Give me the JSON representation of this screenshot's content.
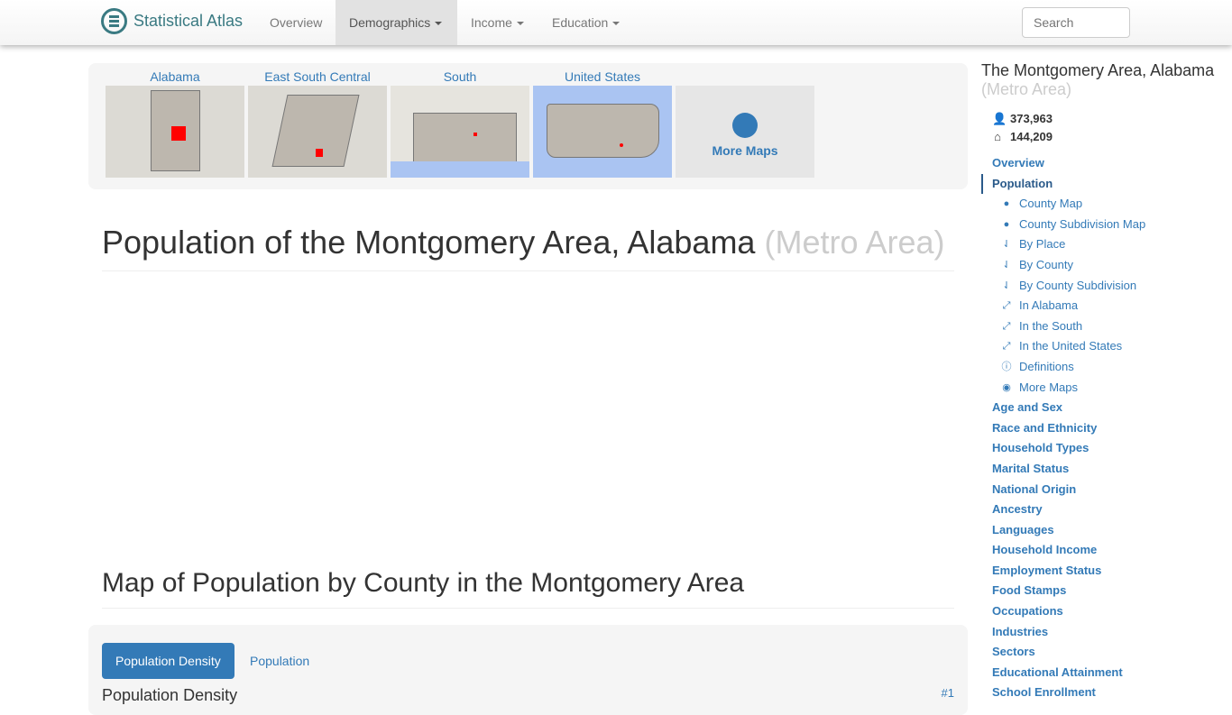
{
  "nav": {
    "brand": "Statistical Atlas",
    "items": [
      {
        "label": "Overview"
      },
      {
        "label": "Demographics",
        "dropdown": true,
        "active": true
      },
      {
        "label": "Income",
        "dropdown": true
      },
      {
        "label": "Education",
        "dropdown": true
      }
    ],
    "search_placeholder": "Search"
  },
  "maps": {
    "thumbs": [
      {
        "label": "Alabama"
      },
      {
        "label": "East South Central"
      },
      {
        "label": "South"
      },
      {
        "label": "United States"
      }
    ],
    "more_label": "More Maps"
  },
  "main": {
    "title": "Population of the Montgomery Area, Alabama",
    "title_muted": "(Metro Area)",
    "section_title": "Map of Population by County in the Montgomery Area",
    "tabs": [
      {
        "label": "Population Density",
        "active": true
      },
      {
        "label": "Population"
      }
    ],
    "subheading": "Population Density",
    "rank": "#1"
  },
  "sidebar": {
    "title": "The Montgomery Area, Alabama",
    "title_muted": "(Metro Area)",
    "population": "373,963",
    "households": "144,209",
    "items_top": [
      {
        "label": "Overview"
      },
      {
        "label": "Population",
        "current": true
      }
    ],
    "subitems": [
      {
        "label": "County Map",
        "icon": "map-marker-icon"
      },
      {
        "label": "County Subdivision Map",
        "icon": "map-marker-icon"
      },
      {
        "label": "By Place",
        "icon": "sort-icon"
      },
      {
        "label": "By County",
        "icon": "sort-icon"
      },
      {
        "label": "By County Subdivision",
        "icon": "sort-icon"
      },
      {
        "label": "In Alabama",
        "icon": "expand-icon"
      },
      {
        "label": "In the South",
        "icon": "expand-icon"
      },
      {
        "label": "In the United States",
        "icon": "expand-icon"
      },
      {
        "label": "Definitions",
        "icon": "info-icon"
      },
      {
        "label": "More Maps",
        "icon": "globe-icon"
      }
    ],
    "items_bottom": [
      "Age and Sex",
      "Race and Ethnicity",
      "Household Types",
      "Marital Status",
      "National Origin",
      "Ancestry",
      "Languages",
      "Household Income",
      "Employment Status",
      "Food Stamps",
      "Occupations",
      "Industries",
      "Sectors",
      "Educational Attainment",
      "School Enrollment"
    ]
  },
  "colors": {
    "link": "#337ab7",
    "brand": "#3a7a82",
    "highlight": "#ff0000"
  }
}
